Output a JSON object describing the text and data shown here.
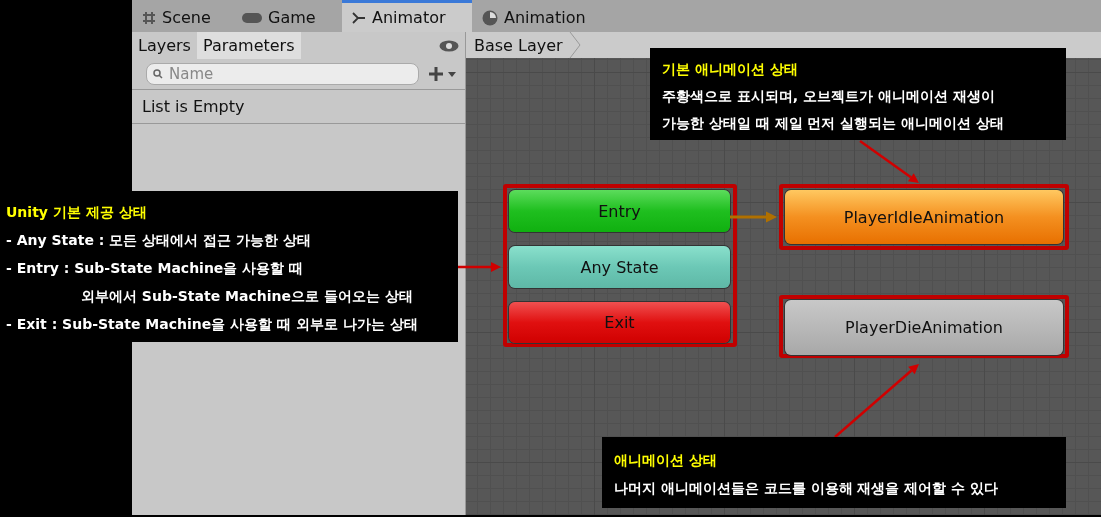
{
  "tabs": [
    {
      "label": "Scene",
      "selected": false
    },
    {
      "label": "Game",
      "selected": false
    },
    {
      "label": "Animator",
      "selected": true
    },
    {
      "label": "Animation",
      "selected": false
    }
  ],
  "parameters_panel": {
    "subtabs": [
      {
        "label": "Layers",
        "selected": false
      },
      {
        "label": "Parameters",
        "selected": true
      }
    ],
    "search": {
      "placeholder": "Name"
    },
    "empty_message": "List is Empty"
  },
  "graph": {
    "breadcrumb": "Base Layer",
    "nodes": [
      {
        "label": "Entry",
        "kind": "entry"
      },
      {
        "label": "Any State",
        "kind": "any"
      },
      {
        "label": "Exit",
        "kind": "exit"
      },
      {
        "label": "PlayerIdleAnimation",
        "kind": "default"
      },
      {
        "label": "PlayerDieAnimation",
        "kind": "normal"
      }
    ]
  },
  "annotations": [
    {
      "title": "Unity 기본 제공 상태",
      "lines": [
        {
          "text": "- Any State : 모든 상태에서 접근 가능한 상태",
          "indented": false
        },
        {
          "text": "- Entry : Sub-State Machine을 사용할 때",
          "indented": false
        },
        {
          "text": "외부에서 Sub-State Machine으로 들어오는 상태",
          "indented": true
        },
        {
          "text": "- Exit : Sub-State Machine을 사용할 때 외부로 나가는 상태",
          "indented": false
        }
      ]
    },
    {
      "title": "기본 애니메이션 상태",
      "lines": [
        {
          "text": "주황색으로 표시되며, 오브젝트가 애니메이션 재생이",
          "indented": false
        },
        {
          "text": "가능한 상태일 때 제일 먼저 실행되는 애니메이션 상태",
          "indented": false
        }
      ]
    },
    {
      "title": "애니메이션 상태",
      "lines": [
        {
          "text": "나머지 애니메이션들은 코드를 이용해 재생을 제어할 수 있다",
          "indented": false
        }
      ]
    }
  ]
}
